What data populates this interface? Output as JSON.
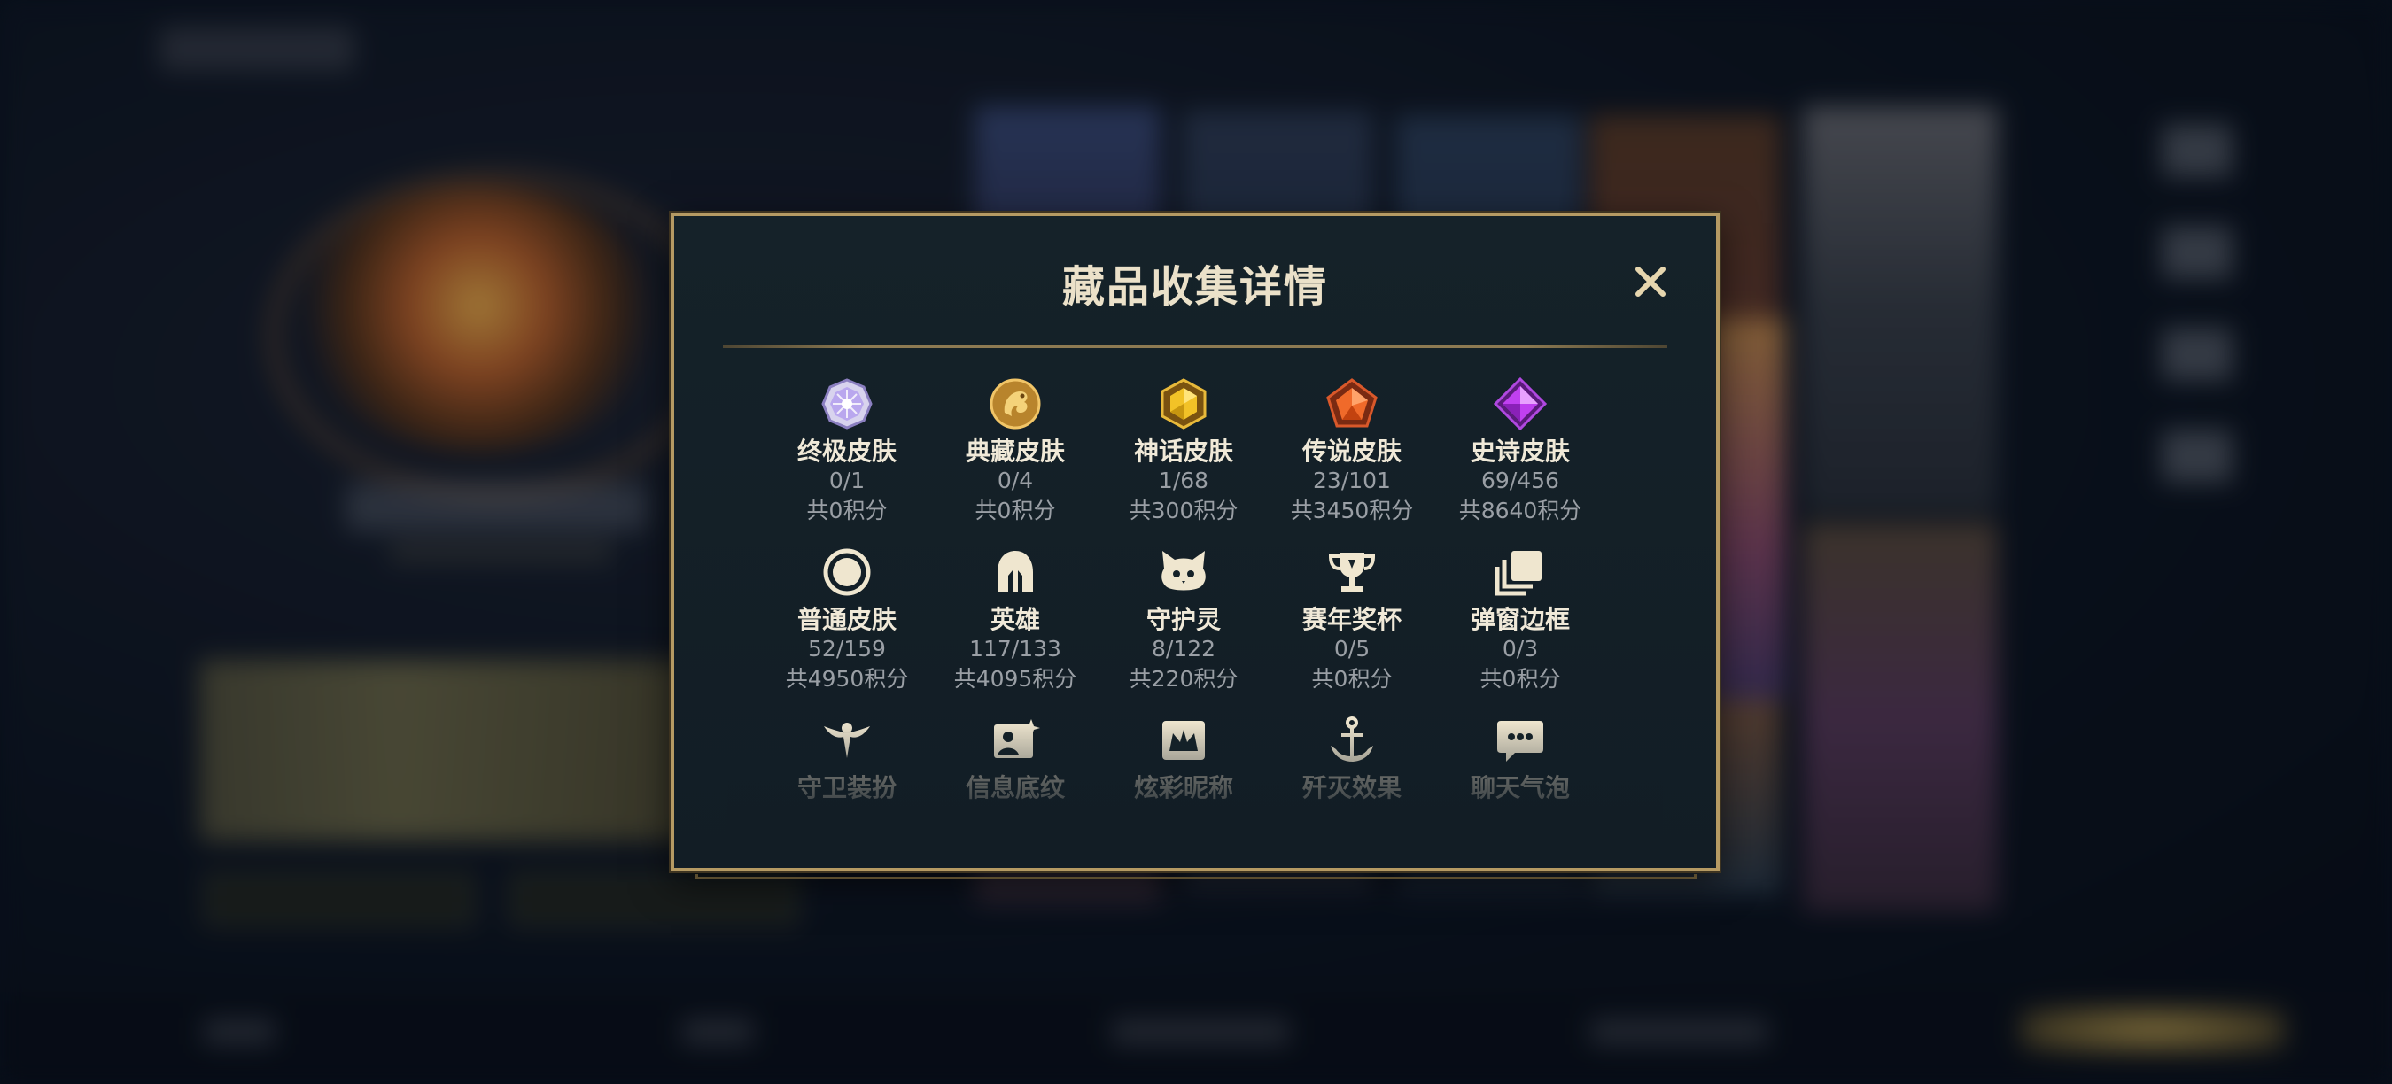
{
  "modal": {
    "title": "藏品收集详情",
    "close_icon": "close-icon",
    "rows": [
      [
        {
          "icon": "ultimate-skin-icon",
          "name": "终极皮肤",
          "count": "0/1",
          "points": "共0积分"
        },
        {
          "icon": "legendary-collection-skin-icon",
          "name": "典藏皮肤",
          "count": "0/4",
          "points": "共0积分"
        },
        {
          "icon": "mythic-skin-icon",
          "name": "神话皮肤",
          "count": "1/68",
          "points": "共300积分"
        },
        {
          "icon": "legend-skin-icon",
          "name": "传说皮肤",
          "count": "23/101",
          "points": "共3450积分"
        },
        {
          "icon": "epic-skin-icon",
          "name": "史诗皮肤",
          "count": "69/456",
          "points": "共8640积分"
        }
      ],
      [
        {
          "icon": "normal-skin-icon",
          "name": "普通皮肤",
          "count": "52/159",
          "points": "共4950积分"
        },
        {
          "icon": "hero-helmet-icon",
          "name": "英雄",
          "count": "117/133",
          "points": "共4095积分"
        },
        {
          "icon": "guardian-spirit-icon",
          "name": "守护灵",
          "count": "8/122",
          "points": "共220积分"
        },
        {
          "icon": "trophy-icon",
          "name": "赛年奖杯",
          "count": "0/5",
          "points": "共0积分"
        },
        {
          "icon": "popup-frame-icon",
          "name": "弹窗边框",
          "count": "0/3",
          "points": "共0积分"
        }
      ],
      [
        {
          "icon": "guardian-outfit-icon",
          "name": "守卫装扮"
        },
        {
          "icon": "info-background-icon",
          "name": "信息底纹"
        },
        {
          "icon": "colorful-nickname-icon",
          "name": "炫彩昵称"
        },
        {
          "icon": "elimination-effect-icon",
          "name": "歼灭效果"
        },
        {
          "icon": "chat-bubble-icon",
          "name": "聊天气泡"
        }
      ]
    ]
  },
  "colors": {
    "accent_gold": "#b59a63",
    "title_text": "#ebe1c9",
    "muted_text": "#9a9fa5",
    "panel_bg": "#152229"
  }
}
